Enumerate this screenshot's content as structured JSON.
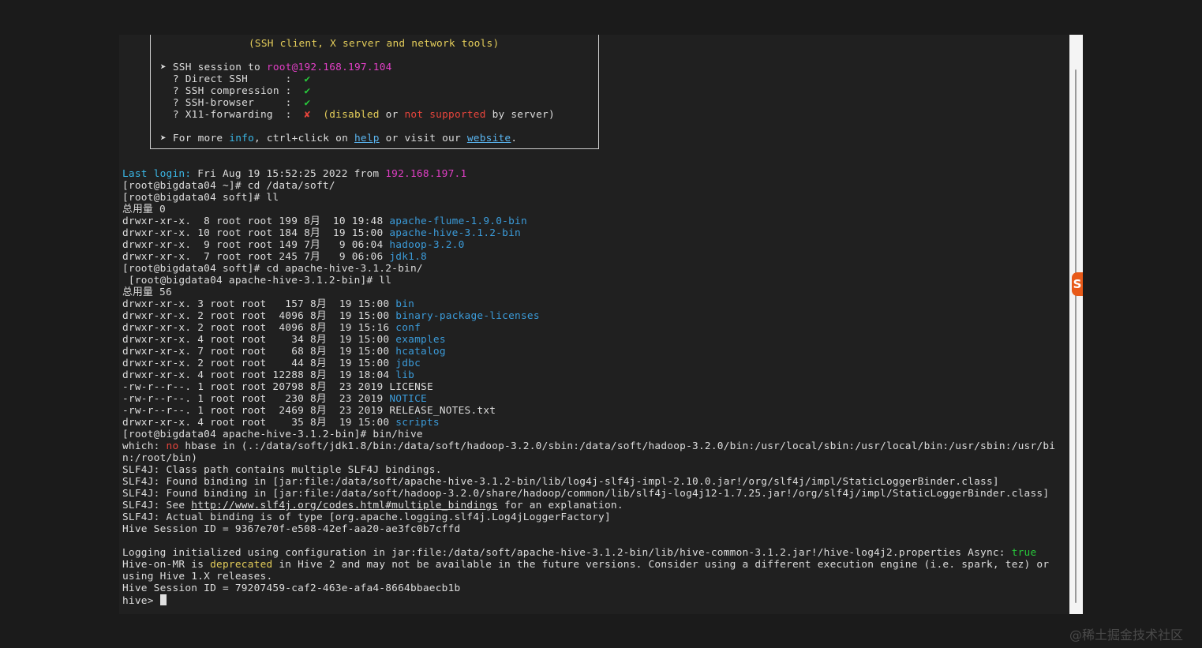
{
  "banner": {
    "tools_line": "(SSH client, X server and network tools)",
    "session_prefix": "➤ SSH session to ",
    "session_host": "root@192.168.197.104",
    "features": [
      {
        "label": "  ? Direct SSH      :  ",
        "mark": "✔"
      },
      {
        "label": "  ? SSH compression :  ",
        "mark": "✔"
      },
      {
        "label": "  ? SSH-browser     :  ",
        "mark": "✔"
      }
    ],
    "x11": {
      "label": "  ? X11-forwarding  :  ",
      "mark": "✘",
      "open": "  (",
      "disabled": "disabled",
      "or": " or ",
      "not_supported": "not supported",
      "by_server": " by server)"
    },
    "more": {
      "prefix": "➤ For more ",
      "info": "info",
      "mid": ", ctrl+click on ",
      "help": "help",
      "mid2": " or visit our ",
      "website": "website",
      "end": "."
    }
  },
  "last_login": {
    "label": "Last login:",
    "text": " Fri Aug 19 15:52:25 2022 from ",
    "ip": "192.168.197.1"
  },
  "session1": [
    "[root@bigdata04 ~]# cd /data/soft/",
    "[root@bigdata04 soft]# ll",
    "总用量 0"
  ],
  "soft_listing": [
    {
      "meta": "drwxr-xr-x.  8 root root 199 8月  10 19:48 ",
      "name": "apache-flume-1.9.0-bin"
    },
    {
      "meta": "drwxr-xr-x. 10 root root 184 8月  19 15:00 ",
      "name": "apache-hive-3.1.2-bin"
    },
    {
      "meta": "drwxr-xr-x.  9 root root 149 7月   9 06:04 ",
      "name": "hadoop-3.2.0"
    },
    {
      "meta": "drwxr-xr-x.  7 root root 245 7月   9 06:06 ",
      "name": "jdk1.8"
    }
  ],
  "session2": [
    "[root@bigdata04 soft]# cd apache-hive-3.1.2-bin/",
    " [root@bigdata04 apache-hive-3.1.2-bin]# ll",
    "总用量 56"
  ],
  "hive_listing": [
    {
      "meta": "drwxr-xr-x. 3 root root   157 8月  19 15:00 ",
      "name": "bin",
      "dir": true
    },
    {
      "meta": "drwxr-xr-x. 2 root root  4096 8月  19 15:00 ",
      "name": "binary-package-licenses",
      "dir": true
    },
    {
      "meta": "drwxr-xr-x. 2 root root  4096 8月  19 15:16 ",
      "name": "conf",
      "dir": true
    },
    {
      "meta": "drwxr-xr-x. 4 root root    34 8月  19 15:00 ",
      "name": "examples",
      "dir": true
    },
    {
      "meta": "drwxr-xr-x. 7 root root    68 8月  19 15:00 ",
      "name": "hcatalog",
      "dir": true
    },
    {
      "meta": "drwxr-xr-x. 2 root root    44 8月  19 15:00 ",
      "name": "jdbc",
      "dir": true
    },
    {
      "meta": "drwxr-xr-x. 4 root root 12288 8月  19 18:04 ",
      "name": "lib",
      "dir": true
    },
    {
      "meta": "-rw-r--r--. 1 root root 20798 8月  23 2019 ",
      "name": "LICENSE",
      "dir": false
    },
    {
      "meta": "-rw-r--r--. 1 root root   230 8月  23 2019 ",
      "name": "NOTICE",
      "dir": true
    },
    {
      "meta": "-rw-r--r--. 1 root root  2469 8月  23 2019 ",
      "name": "RELEASE_NOTES.txt",
      "dir": false
    },
    {
      "meta": "drwxr-xr-x. 4 root root    35 8月  19 15:00 ",
      "name": "scripts",
      "dir": true
    }
  ],
  "hive_cmd": "[root@bigdata04 apache-hive-3.1.2-bin]# bin/hive",
  "which_line": {
    "a": "which: ",
    "no": "no",
    "b": " hbase in (.:/data/soft/jdk1.8/bin:/data/soft/hadoop-3.2.0/sbin:/data/soft/hadoop-3.2.0/bin:/usr/local/sbin:/usr/local/bin:/usr/sbin:/usr/bi"
  },
  "which_cont": "n:/root/bin)",
  "slf4j": {
    "l1": "SLF4J: Class path contains multiple SLF4J bindings.",
    "l2": "SLF4J: Found binding in [jar:file:/data/soft/apache-hive-3.1.2-bin/lib/log4j-slf4j-impl-2.10.0.jar!/org/slf4j/impl/StaticLoggerBinder.class]",
    "l3": "SLF4J: Found binding in [jar:file:/data/soft/hadoop-3.2.0/share/hadoop/common/lib/slf4j-log4j12-1.7.25.jar!/org/slf4j/impl/StaticLoggerBinder.class]",
    "l4_prefix": "SLF4J: See ",
    "l4_link": "http://www.slf4j.org/codes.html#multiple_bindings",
    "l4_suffix": " for an explanation.",
    "l5": "SLF4J: Actual binding is of type [org.apache.logging.slf4j.Log4jLoggerFactory]"
  },
  "session_id_1": "Hive Session ID = 9367e70f-e508-42ef-aa20-ae3fc0b7cffd",
  "logging": {
    "text": "Logging initialized using configuration in jar:file:/data/soft/apache-hive-3.1.2-bin/lib/hive-common-3.1.2.jar!/hive-log4j2.properties Async: ",
    "value": "true"
  },
  "hive_mr": {
    "a": "Hive-on-MR is ",
    "deprecated": "deprecated",
    "b": " in Hive 2 and may not be available in the future versions. Consider using a different execution engine (i.e. spark, tez) or"
  },
  "hive_mr_cont": "using Hive 1.X releases.",
  "session_id_2": "Hive Session ID = 79207459-caf2-463e-afa4-8664bbaecb1b",
  "prompt": "hive> ",
  "side_logo": "S",
  "watermark": "@稀土掘金技术社区"
}
